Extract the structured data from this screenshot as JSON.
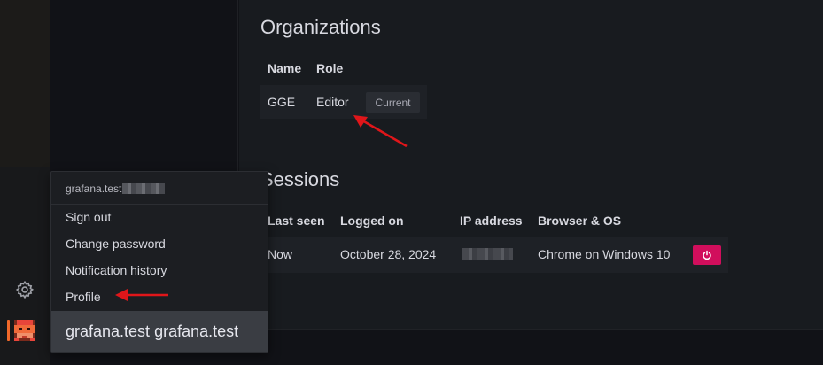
{
  "organizations": {
    "title": "Organizations",
    "columns": [
      "Name",
      "Role"
    ],
    "rows": [
      {
        "name": "GGE",
        "role": "Editor",
        "badge": "Current"
      }
    ]
  },
  "sessions": {
    "title": "Sessions",
    "columns": [
      "Last seen",
      "Logged on",
      "IP address",
      "Browser & OS"
    ],
    "rows": [
      {
        "last_seen": "Now",
        "logged_on": "October 28, 2024",
        "ip_address": "",
        "browser": "Chrome on Windows 10"
      }
    ]
  },
  "profile_menu": {
    "header": "grafana.test",
    "items": [
      "Sign out",
      "Change password",
      "Notification history",
      "Profile"
    ],
    "footer": "grafana.test grafana.test"
  },
  "sidebar": {
    "icons": [
      "gear-icon",
      "avatar-icon"
    ]
  },
  "colors": {
    "revoke_button": "#d10e5c",
    "active_indicator": "#f2692a",
    "annotation_arrow": "#e0161a"
  }
}
